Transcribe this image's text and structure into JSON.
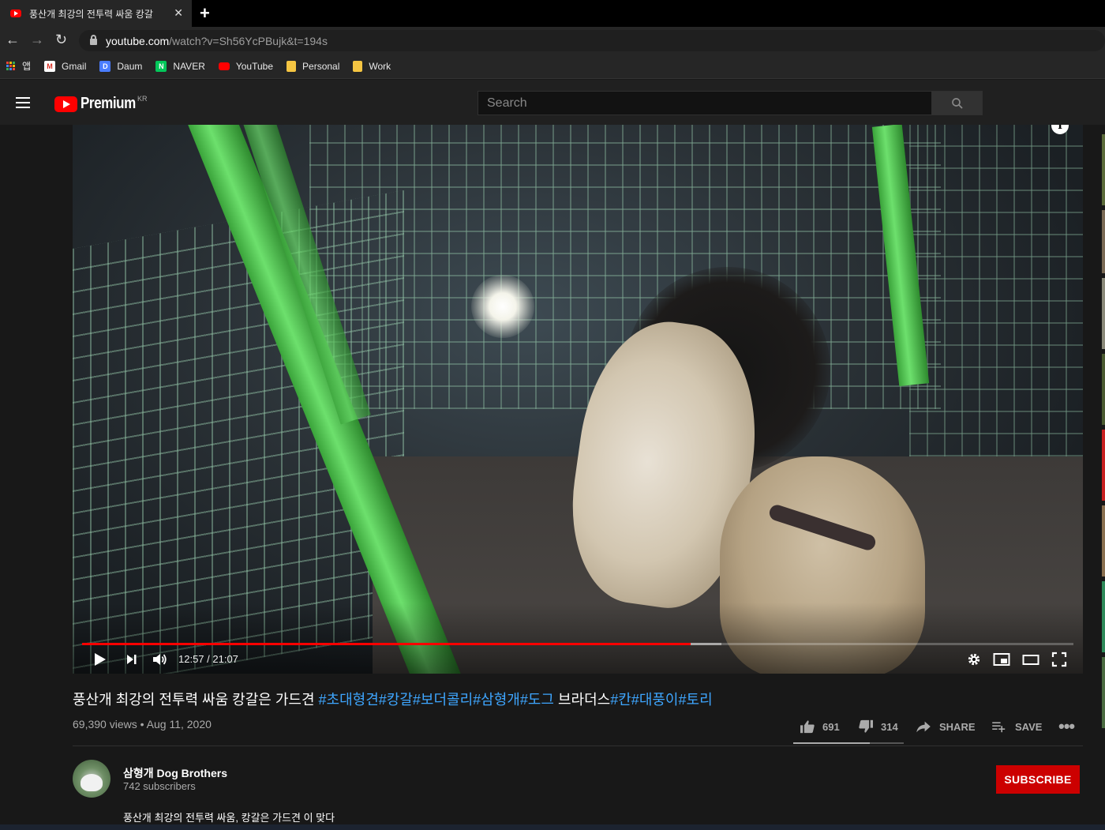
{
  "browser": {
    "tab_title": "풍산개 최강의 전투력 싸움 캉갈",
    "url_host": "youtube.com",
    "url_path": "/watch?v=Sh56YcPBujk&t=194s",
    "bookmarks": [
      {
        "label": "앱",
        "icon": "apps-icon"
      },
      {
        "label": "Gmail",
        "icon": "gmail-icon",
        "color": "#d93025"
      },
      {
        "label": "Daum",
        "icon": "daum-icon",
        "color": "#4a7dff"
      },
      {
        "label": "NAVER",
        "icon": "naver-icon",
        "color": "#03c75a"
      },
      {
        "label": "YouTube",
        "icon": "youtube-icon",
        "color": "#ff0000"
      },
      {
        "label": "Personal",
        "icon": "folder-icon",
        "color": "#f5c542"
      },
      {
        "label": "Work",
        "icon": "folder-icon",
        "color": "#f5c542"
      }
    ]
  },
  "header": {
    "logo_word": "Premium",
    "region": "KR",
    "search_placeholder": "Search"
  },
  "player": {
    "time_display": "12:57 / 21:07",
    "played_fraction": 0.614,
    "buffered_fraction": 0.645
  },
  "video": {
    "title_text": "풍산개 최강의 전투력 싸움 캉갈은 가드견 ",
    "tags_a": "#초대형견#캉갈#보더콜리#삼형개#도그",
    "title_mid": " 브라더스",
    "tags_b": "#칸#대풍이#토리",
    "views": "69,390 views",
    "date": "Aug 11, 2020",
    "likes": "691",
    "dislikes": "314",
    "share_label": "SHARE",
    "save_label": "SAVE",
    "like_ratio": 0.69
  },
  "channel": {
    "name": "삼형개 Dog Brothers",
    "subscribers": "742 subscribers",
    "subscribe_label": "SUBSCRIBE"
  },
  "description": {
    "first_line": "풍산개 최강의 전투력 싸움, 캉갈은 가드견 이 맞다"
  },
  "colors": {
    "accent_red": "#ff0000",
    "hashtag_blue": "#3ea6ff",
    "subscribe_red": "#cc0000"
  }
}
